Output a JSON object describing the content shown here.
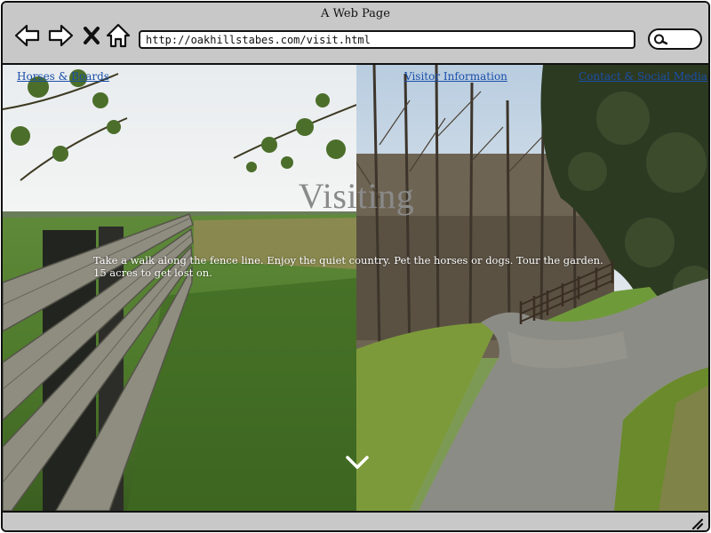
{
  "window": {
    "title": "A Web Page",
    "url": "http://oakhillstabes.com/visit.html"
  },
  "icons": {
    "back": "arrow-left-icon",
    "forward": "arrow-right-icon",
    "stop": "close-icon",
    "home": "home-icon",
    "search": "search-icon",
    "scroll": "chevron-down-icon",
    "resize": "resize-grip-icon"
  },
  "nav": {
    "links": [
      {
        "label": "Horses & Boards"
      },
      {
        "label": "Visitor Information"
      },
      {
        "label": "Contact & Social Media"
      }
    ]
  },
  "hero": {
    "title": "Visiting",
    "text": "Take a walk along the fence line. Enjoy the quiet country. Pet the horses or dogs. Tour the garden. 15 acres to get lost on."
  },
  "colors": {
    "chrome": "#c8c8c8",
    "link": "#1a4fa8",
    "title_text": "#8a8a8a"
  }
}
